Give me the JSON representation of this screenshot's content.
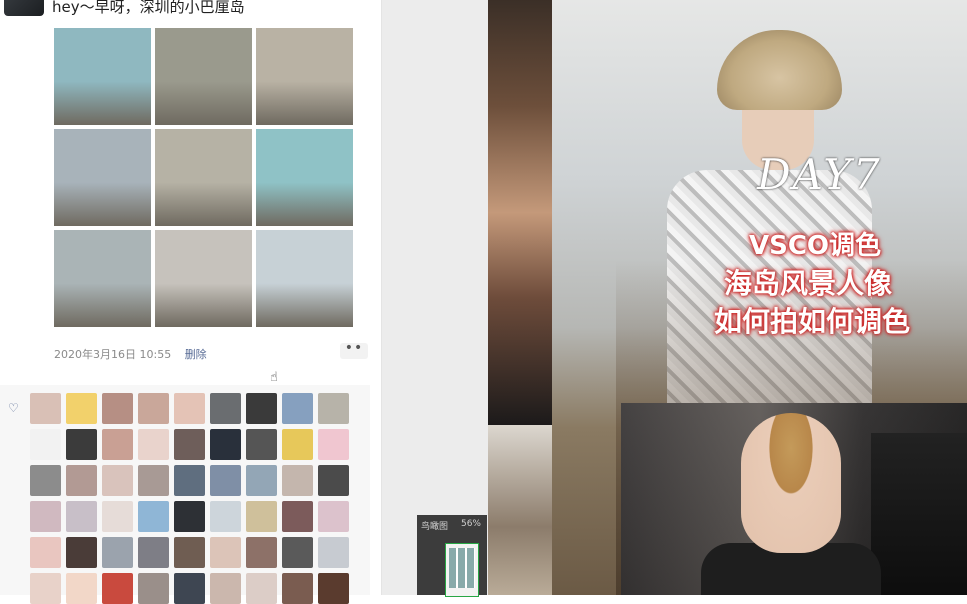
{
  "post": {
    "text": "hey～早呀，深圳的小巴厘岛",
    "timestamp": "2020年3月16日 10:55",
    "delete_label": "删除",
    "more_label": "••"
  },
  "photo_grid": {
    "colors": [
      "#8fb8c0",
      "#9a9a8d",
      "#b9b2a4",
      "#a8b3ba",
      "#b6b2a5",
      "#8fc2c6",
      "#aab4b6",
      "#c6c2bc",
      "#c7d1d6"
    ]
  },
  "likes": {
    "heart_icon": "heart-icon",
    "avatar_colors": [
      "#d9c0b6",
      "#f2d16b",
      "#b68f84",
      "#c9a79a",
      "#e4c3b6",
      "#6a6d70",
      "#3a3a3a",
      "#86a0bf",
      "#b7b3a9",
      "#f2f2f2",
      "#3b3b3b",
      "#c9a094",
      "#e9d3cc",
      "#6e5e5a",
      "#29303b",
      "#555",
      "#e7c85a",
      "#f0c6d0",
      "#8c8c8c",
      "#b29a94",
      "#d9c3bc",
      "#a89a95",
      "#5f6e7f",
      "#7f8fa6",
      "#93a6b6",
      "#c4b6ad",
      "#4b4b4b",
      "#d0b9c0",
      "#c8bfc8",
      "#e6dcd8",
      "#8fb6d6",
      "#2d3035",
      "#cdd5db",
      "#cfc09b",
      "#7c5b5b",
      "#dcc2cc",
      "#e9c6c0",
      "#4a3c38",
      "#9ba3ad",
      "#7e7e86",
      "#6f5d52",
      "#dcc4b8",
      "#8d7168",
      "#5a5a5a",
      "#c7cbd1",
      "#e8d2c9",
      "#f2d7c8",
      "#c94a3e",
      "#9a8f8a",
      "#3e4652",
      "#cbb7ad",
      "#dccdc7",
      "#7a5c50",
      "#5a3b2e"
    ]
  },
  "cover": {
    "day_label": "DAY7",
    "line1": "VSCO调色",
    "line2": "海岛风景人像",
    "line3": "如何拍如何调色"
  },
  "navigator": {
    "label": "鸟瞰图",
    "zoom": "56%"
  }
}
